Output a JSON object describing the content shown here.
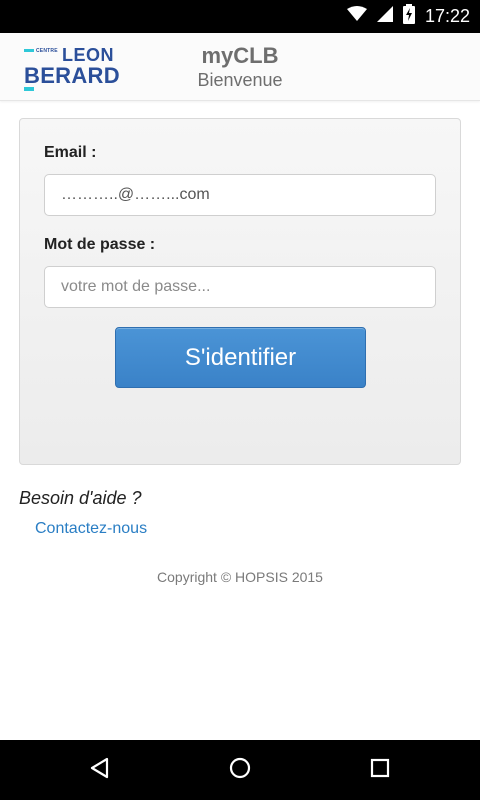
{
  "status_bar": {
    "time": "17:22",
    "icons": [
      "wifi-icon",
      "signal-icon",
      "battery-charging-icon"
    ]
  },
  "header": {
    "logo": {
      "small_text": "CENTRE",
      "line1": "LEON",
      "line2": "BERARD"
    },
    "title": "myCLB",
    "subtitle": "Bienvenue"
  },
  "login_form": {
    "email_label": "Email :",
    "email_value": "………..@……...com",
    "password_label": "Mot de passe :",
    "password_placeholder": "votre mot de passe...",
    "submit_label": "S'identifier"
  },
  "help": {
    "question": "Besoin d'aide ?",
    "contact_link": "Contactez-nous"
  },
  "footer": {
    "copyright": "Copyright © HOPSIS 2015"
  },
  "nav_bar": {
    "buttons": [
      "back-icon",
      "home-icon",
      "recents-icon"
    ]
  },
  "colors": {
    "accent": "#3a82c8",
    "link": "#2a7ec4",
    "brand": "#2b4f9a",
    "brand_secondary": "#2ec8d8"
  }
}
